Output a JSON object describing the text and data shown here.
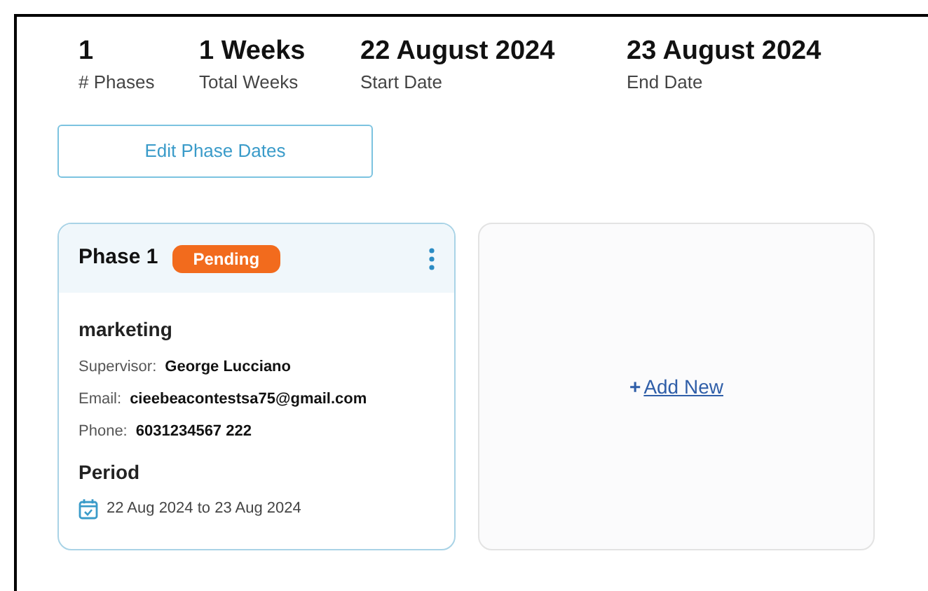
{
  "stats": [
    {
      "value": "1",
      "label": "# Phases"
    },
    {
      "value": "1 Weeks",
      "label": "Total Weeks"
    },
    {
      "value": "22 August 2024",
      "label": "Start Date"
    },
    {
      "value": "23 August 2024",
      "label": "End Date"
    }
  ],
  "edit_button": "Edit Phase Dates",
  "phases": [
    {
      "title": "Phase 1",
      "status": "Pending",
      "name": "marketing",
      "fields": [
        {
          "label": "Supervisor:",
          "value": "George Lucciano"
        },
        {
          "label": "Email:",
          "value": "cieebeacontestsa75@gmail.com"
        },
        {
          "label": "Phone:",
          "value": "6031234567 222"
        }
      ],
      "period_label": "Period",
      "period": "22 Aug 2024 to 23 Aug 2024"
    }
  ],
  "add_new": {
    "plus": "+",
    "label": "Add New"
  }
}
